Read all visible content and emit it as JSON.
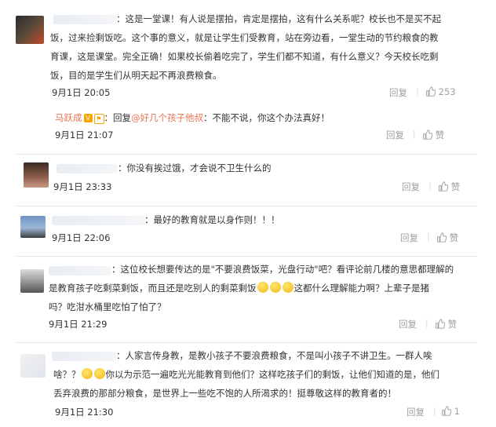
{
  "comments": [
    {
      "lines": [
        "：这是一堂课！有人说是摆拍，肯定是摆拍，这有什么关系呢？校长也不是买不起",
        "饭，过来捡剩饭吃。这个事的意义，就是让学生们受教育，站在旁边看，一堂生动的节约粮食的教",
        "育课，这是课堂。完全正确！如果校长偷着吃完了，学生们都不知道，有什么意义？今天校长吃剩",
        "饭，目的是学生们从明天起不再浪费粮食。"
      ],
      "time": "9月1日 20:05",
      "reply": "回复",
      "likes": "253"
    },
    {
      "username": "马跃成",
      "v": "V",
      "org": "⚑",
      "prefix": "：回复",
      "mention": "@好几个孩子他叔",
      "text": "：不能不说，你这个办法真好！",
      "time": "9月1日 21:07",
      "reply": "回复",
      "likes": "赞"
    },
    {
      "lines": [
        "：你没有挨过饿，才会说不卫生什么的"
      ],
      "time": "9月1日 23:33",
      "reply": "回复",
      "likes": "赞"
    },
    {
      "lines": [
        "：最好的教育就是以身作则！！！"
      ],
      "time": "9月1日 22:06",
      "reply": "回复",
      "likes": "赞"
    },
    {
      "line1": "：这位校长想要传达的是\"不要浪费饭菜，光盘行动\"吧？看评论前几楼的意思都理解的",
      "line2a": "是教育孩子吃剩菜剩饭，而且还是吃别人的剩菜剩饭",
      "line2b": "这都什么理解能力啊？上辈子是猪",
      "line3": "吗？吃泔水桶里吃怕了怕了？",
      "time": "9月1日 21:29",
      "reply": "回复",
      "likes": "赞"
    },
    {
      "line1": "：人家言传身教，是教小孩子不要浪费粮食，不是叫小孩子不讲卫生。一群人唉",
      "line2a": "啥？？",
      "line2b": "你以为示范一遍吃光光能教育到他们？这样吃孩子们的剩饭，让他们知道的是，他们",
      "line3": "丢弃浪费的那部分粮食，是世界上一些吃不饱的人所渴求的！挺尊敬这样的教育者的！",
      "time": "9月1日 21:30",
      "reply": "回复",
      "likes": "1"
    }
  ],
  "colors": {
    "link": "#eb7350",
    "muted": "#a0a0a0",
    "text": "#333333",
    "subreply_bg": "#f2f2f5"
  },
  "icons": [
    "thumbs-up-icon",
    "emoji-face-icon",
    "vip-badge-icon"
  ]
}
